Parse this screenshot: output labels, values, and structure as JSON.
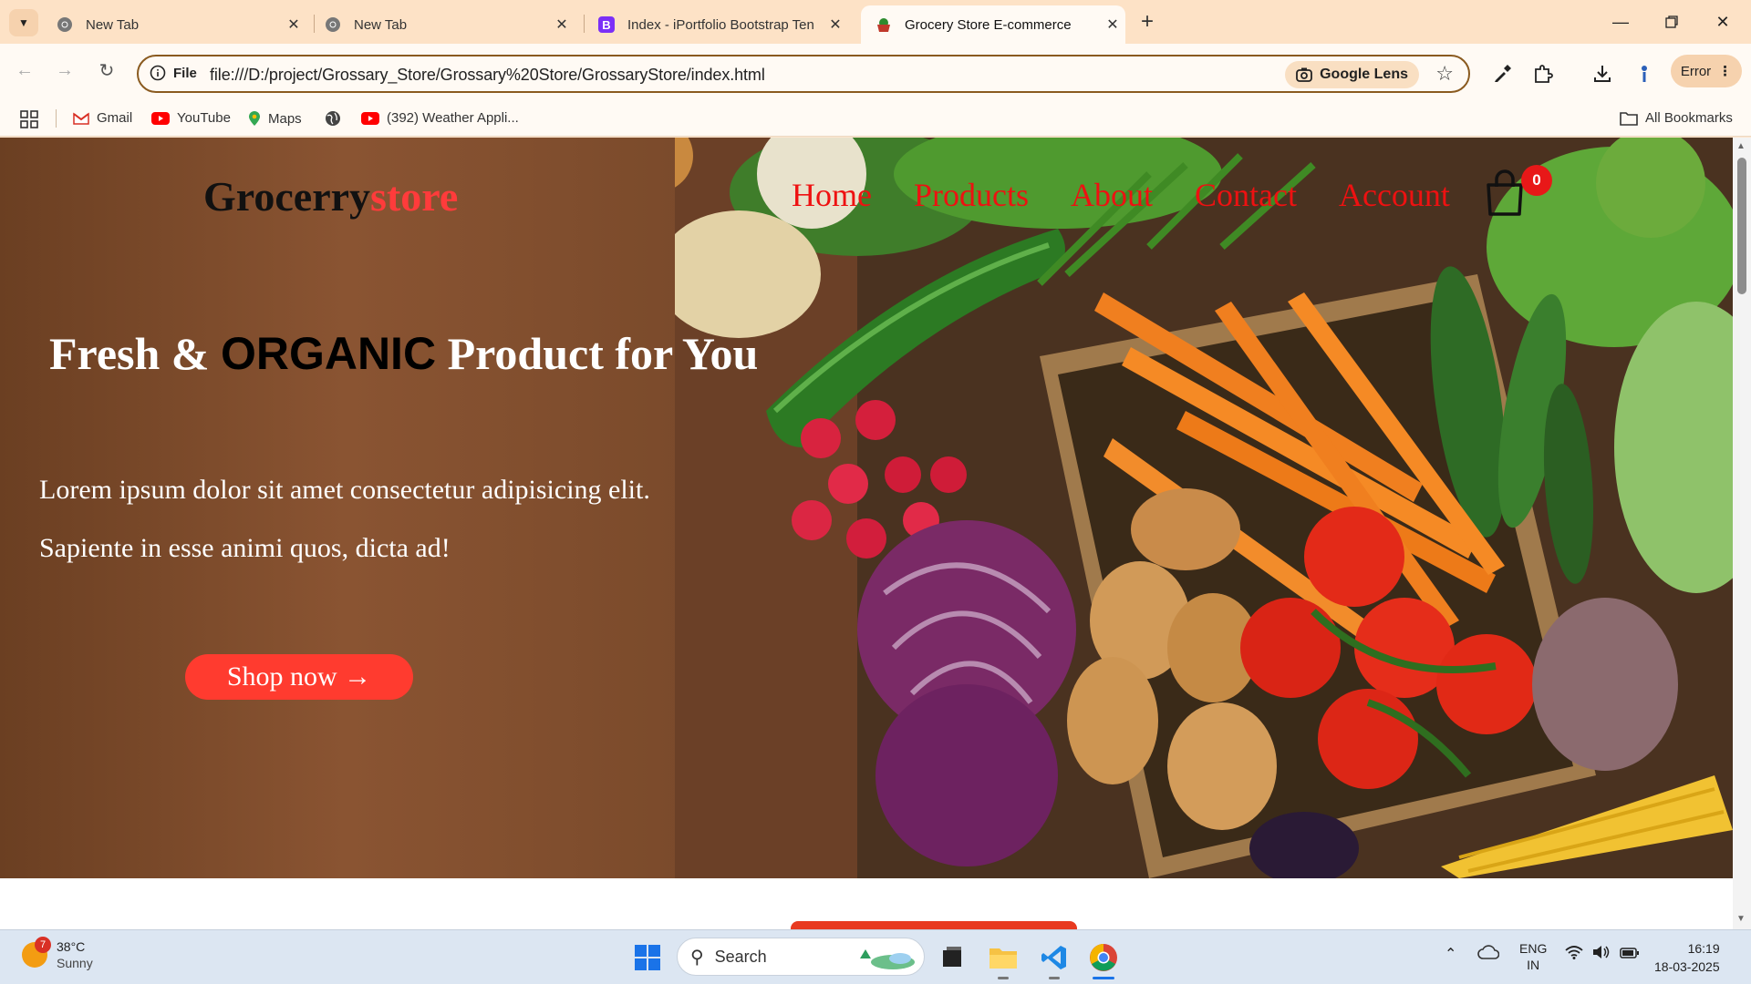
{
  "browser": {
    "tabs": [
      {
        "title": "New Tab",
        "favicon": "chrome-icon"
      },
      {
        "title": "New Tab",
        "favicon": "chrome-icon"
      },
      {
        "title": "Index - iPortfolio Bootstrap Ten",
        "favicon": "bootstrap-icon"
      },
      {
        "title": "Grocery Store E-commerce",
        "favicon": "basket-icon",
        "active": true
      }
    ],
    "address": {
      "scheme_label": "File",
      "url": "file:///D:/project/Grossary_Store/Grossary%20Store/GrossaryStore/index.html",
      "lens_label": "Google Lens"
    },
    "profile_button_label": "Error",
    "bookmarks": [
      {
        "label": "Gmail",
        "icon": "gmail-icon"
      },
      {
        "label": "YouTube",
        "icon": "youtube-icon"
      },
      {
        "label": "Maps",
        "icon": "maps-icon"
      },
      {
        "label": "",
        "icon": "globe-icon"
      },
      {
        "label": "(392) Weather Appli...",
        "icon": "youtube-icon"
      }
    ],
    "all_bookmarks_label": "All Bookmarks"
  },
  "page": {
    "logo": {
      "part1": "Grocerry",
      "part2": "store"
    },
    "nav": [
      "Home",
      "Products",
      "About",
      "Contact",
      "Account"
    ],
    "cart_count": "0",
    "hero": {
      "title_pre": "Fresh & ",
      "title_strong": "ORGANIC",
      "title_post": " Product for You",
      "line1": "Lorem ipsum dolor sit amet consectetur adipisicing elit.",
      "line2": "Sapiente in esse animi quos, dicta ad!",
      "cta": "Shop now →"
    },
    "colors": {
      "accent": "#ff3b2f",
      "nav_link": "#ee1111"
    }
  },
  "taskbar": {
    "weather": {
      "temp": "38°C",
      "condition": "Sunny",
      "badge": "7"
    },
    "search_placeholder": "Search",
    "lang": {
      "line1": "ENG",
      "line2": "IN"
    },
    "time": "16:19",
    "date": "18-03-2025"
  }
}
